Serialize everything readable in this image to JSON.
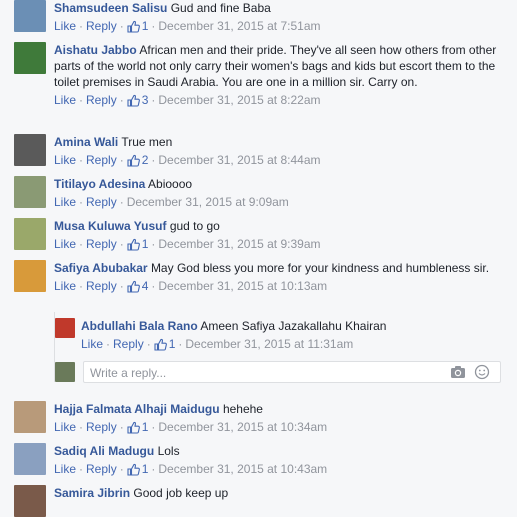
{
  "actions": {
    "like": "Like",
    "reply": "Reply",
    "sep": "·"
  },
  "reply_box": {
    "placeholder": "Write a reply..."
  },
  "comments": [
    {
      "author": "Shamsudeen Salisu",
      "text": "Gud and fine Baba",
      "likes": "1",
      "time": "December 31, 2015 at 7:51am",
      "avatar_color": "#6b8fb5"
    },
    {
      "author": "Aishatu Jabbo",
      "text": "African men and their pride. They've all seen how others from other parts of the world not only carry their women's bags and kids but escort them to the toilet premises in Saudi Arabia. You are one in a million sir. Carry on.",
      "likes": "3",
      "time": "December 31, 2015 at 8:22am",
      "avatar_color": "#3f7a3a"
    },
    {
      "author": "Amina Wali",
      "text": "True men",
      "likes": "2",
      "time": "December 31, 2015 at 8:44am",
      "avatar_color": "#5a5a5a"
    },
    {
      "author": "Titilayo Adesina",
      "text": "Abioooo",
      "likes": "",
      "time": "December 31, 2015 at 9:09am",
      "avatar_color": "#8a9a74"
    },
    {
      "author": "Musa Kuluwa Yusuf",
      "text": "gud to go",
      "likes": "1",
      "time": "December 31, 2015 at 9:39am",
      "avatar_color": "#9aa86a"
    },
    {
      "author": "Safiya Abubakar",
      "text": "May God bless you more for your kindness and humbleness sir.",
      "likes": "4",
      "time": "December 31, 2015 at 10:13am",
      "avatar_color": "#d89a3a"
    },
    {
      "author": "Hajja Falmata Alhaji Maidugu",
      "text": "hehehe",
      "likes": "1",
      "time": "December 31, 2015 at 10:34am",
      "avatar_color": "#b89a7a"
    },
    {
      "author": "Sadiq Ali Madugu",
      "text": "Lols",
      "likes": "1",
      "time": "December 31, 2015 at 10:43am",
      "avatar_color": "#8aa0c0"
    },
    {
      "author": "Samira Jibrin",
      "text": "Good job keep up",
      "likes": "",
      "time": "",
      "avatar_color": "#7a5a4a"
    }
  ],
  "replies": [
    {
      "author": "Abdullahi Bala Rano",
      "text": "Ameen Safiya Jazakallahu Khairan",
      "likes": "1",
      "time": "December 31, 2015 at 11:31am",
      "avatar_color": "#c0392b"
    }
  ],
  "reply_box_avatar_color": "#6a7a5a"
}
